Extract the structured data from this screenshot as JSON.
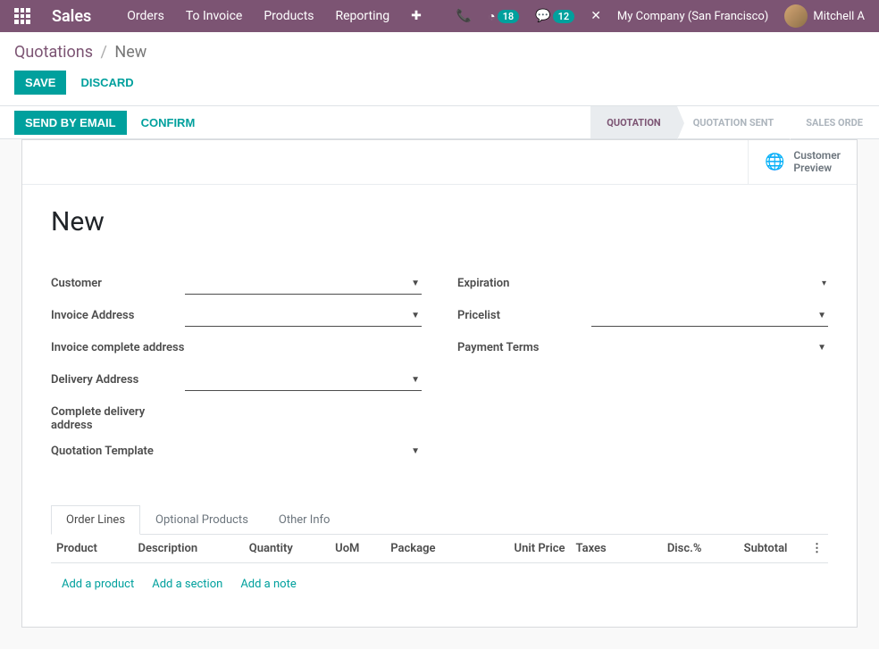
{
  "header": {
    "brand": "Sales",
    "menu": [
      "Orders",
      "To Invoice",
      "Products",
      "Reporting"
    ],
    "badge_activity": "18",
    "badge_discuss": "12",
    "company": "My Company (San Francisco)",
    "user": "Mitchell A"
  },
  "breadcrumb": {
    "root": "Quotations",
    "current": "New"
  },
  "actions": {
    "save": "SAVE",
    "discard": "DISCARD",
    "send_email": "SEND BY EMAIL",
    "confirm": "CONFIRM"
  },
  "steps": {
    "quotation": "QUOTATION",
    "sent": "QUOTATION SENT",
    "order": "SALES ORDE"
  },
  "stat": {
    "preview_l1": "Customer",
    "preview_l2": "Preview"
  },
  "form": {
    "title": "New",
    "left": {
      "customer": "Customer",
      "invoice_addr": "Invoice Address",
      "invoice_complete": "Invoice complete address",
      "delivery_addr": "Delivery Address",
      "delivery_complete": "Complete delivery address",
      "template": "Quotation Template"
    },
    "right": {
      "expiration": "Expiration",
      "pricelist": "Pricelist",
      "payment_terms": "Payment Terms"
    }
  },
  "tabs": {
    "order_lines": "Order Lines",
    "optional": "Optional Products",
    "other": "Other Info"
  },
  "table": {
    "cols": {
      "product": "Product",
      "description": "Description",
      "quantity": "Quantity",
      "uom": "UoM",
      "package": "Package",
      "unit_price": "Unit Price",
      "taxes": "Taxes",
      "disc": "Disc.%",
      "subtotal": "Subtotal"
    },
    "add_product": "Add a product",
    "add_section": "Add a section",
    "add_note": "Add a note"
  }
}
